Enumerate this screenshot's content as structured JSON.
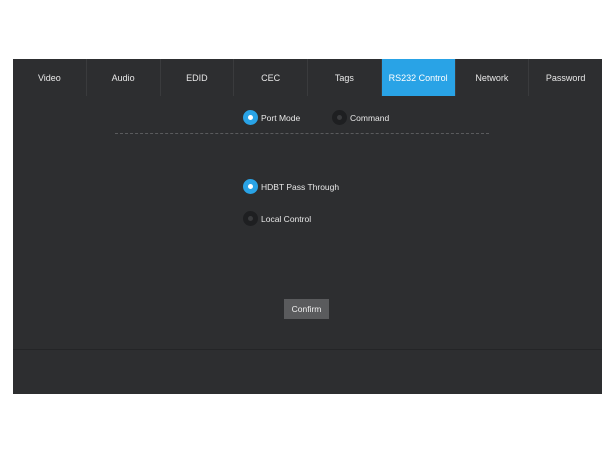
{
  "tabs": [
    {
      "label": "Video",
      "active": false
    },
    {
      "label": "Audio",
      "active": false
    },
    {
      "label": "EDID",
      "active": false
    },
    {
      "label": "CEC",
      "active": false
    },
    {
      "label": "Tags",
      "active": false
    },
    {
      "label": "RS232 Control",
      "active": true
    },
    {
      "label": "Network",
      "active": false
    },
    {
      "label": "Password",
      "active": false
    }
  ],
  "mode": {
    "port_mode": {
      "label": "Port Mode",
      "selected": true
    },
    "command": {
      "label": "Command",
      "selected": false
    }
  },
  "control": {
    "hdbt": {
      "label": "HDBT Pass Through",
      "selected": true
    },
    "local": {
      "label": "Local Control",
      "selected": false
    }
  },
  "confirm_label": "Confirm",
  "colors": {
    "accent": "#29a3e6",
    "panel_bg": "#2d2e30",
    "button_bg": "#5a5b5d"
  }
}
